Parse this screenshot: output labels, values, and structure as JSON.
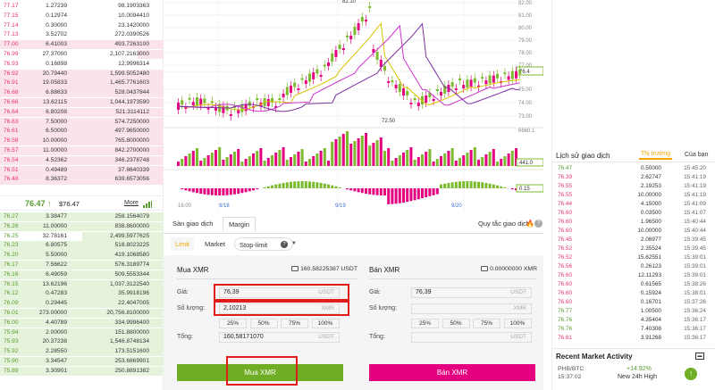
{
  "orderbook": {
    "asks": [
      {
        "price": "77.17",
        "amount": "1.27239",
        "total": "98.1903363",
        "depth": 0.0
      },
      {
        "price": "77.15",
        "amount": "0.12974",
        "total": "10.0094410",
        "depth": 0.0
      },
      {
        "price": "77.14",
        "amount": "0.30000",
        "total": "23.1420000",
        "depth": 0.0
      },
      {
        "price": "77.13",
        "amount": "3.52702",
        "total": "272.0390526",
        "depth": 0.0
      },
      {
        "price": "77.00",
        "amount": "6.41003",
        "total": "493.7263100",
        "depth": 1.0
      },
      {
        "price": "76.99",
        "amount": "27.37000",
        "total": "2,107.2163000",
        "depth": 0.16
      },
      {
        "price": "76.93",
        "amount": "0.16898",
        "total": "12.9996314",
        "depth": 0.0
      },
      {
        "price": "76.92",
        "amount": "20.79440",
        "total": "1,599.5052480",
        "depth": 1.0
      },
      {
        "price": "76.91",
        "amount": "19.05833",
        "total": "1,465.7761603",
        "depth": 1.0
      },
      {
        "price": "76.68",
        "amount": "6.88633",
        "total": "528.0437844",
        "depth": 1.0
      },
      {
        "price": "76.66",
        "amount": "13.62115",
        "total": "1,044.1973590",
        "depth": 1.0
      },
      {
        "price": "76.64",
        "amount": "6.80208",
        "total": "521.3114112",
        "depth": 1.0
      },
      {
        "price": "76.63",
        "amount": "7.50000",
        "total": "574.7250000",
        "depth": 1.0
      },
      {
        "price": "76.61",
        "amount": "6.50000",
        "total": "497.9650000",
        "depth": 1.0
      },
      {
        "price": "76.58",
        "amount": "10.00000",
        "total": "765.8000000",
        "depth": 1.0
      },
      {
        "price": "76.57",
        "amount": "11.00000",
        "total": "842.2700000",
        "depth": 1.0
      },
      {
        "price": "76.54",
        "amount": "4.52362",
        "total": "346.2378748",
        "depth": 1.0
      },
      {
        "price": "76.51",
        "amount": "0.49489",
        "total": "37.8640339",
        "depth": 1.0
      },
      {
        "price": "76.48",
        "amount": "8.36372",
        "total": "639.6573056",
        "depth": 1.0
      }
    ],
    "last_price": "76.47",
    "last_arrow": "↑",
    "last_usd": "$76.47",
    "more_label": "More",
    "bids": [
      {
        "price": "76.27",
        "amount": "3.38477",
        "total": "258.1564079",
        "depth": 1.0
      },
      {
        "price": "76.26",
        "amount": "11.00000",
        "total": "838.8600000",
        "depth": 1.0
      },
      {
        "price": "76.25",
        "amount": "32.78161",
        "total": "2,499.5977625",
        "depth": 0.5
      },
      {
        "price": "76.23",
        "amount": "6.80575",
        "total": "518.8023225",
        "depth": 1.0
      },
      {
        "price": "76.20",
        "amount": "5.50000",
        "total": "419.1068580",
        "depth": 1.0
      },
      {
        "price": "76.17",
        "amount": "7.56622",
        "total": "576.3189774",
        "depth": 1.0
      },
      {
        "price": "76.16",
        "amount": "6.49059",
        "total": "509.5553344",
        "depth": 1.0
      },
      {
        "price": "76.15",
        "amount": "13.62196",
        "total": "1,037.3122540",
        "depth": 1.0
      },
      {
        "price": "76.12",
        "amount": "0.47283",
        "total": "35.9918196",
        "depth": 1.0
      },
      {
        "price": "76.09",
        "amount": "0.29445",
        "total": "22.4047005",
        "depth": 1.0
      },
      {
        "price": "76.01",
        "amount": "273.00000",
        "total": "20,756.8100000",
        "depth": 1.0
      },
      {
        "price": "76.00",
        "amount": "4.40789",
        "total": "334.9996400",
        "depth": 1.0
      },
      {
        "price": "75.94",
        "amount": "2.00000",
        "total": "151.8800000",
        "depth": 1.0
      },
      {
        "price": "75.93",
        "amount": "20.37238",
        "total": "1,546.8748134",
        "depth": 1.0
      },
      {
        "price": "75.92",
        "amount": "2.28550",
        "total": "173.5151600",
        "depth": 1.0
      },
      {
        "price": "75.90",
        "amount": "3.34547",
        "total": "253.6869901",
        "depth": 1.0
      },
      {
        "price": "75.89",
        "amount": "3.30901",
        "total": "250.8891382",
        "depth": 1.0
      }
    ]
  },
  "chart": {
    "y_ticks": [
      "82.00",
      "81.00",
      "80.00",
      "79.00",
      "78.00",
      "77.00",
      "76.4",
      "75.00",
      "74.00",
      "73.00"
    ],
    "high_label": "82.10",
    "low_label": "72.50",
    "current_label": "76.4",
    "x_labels": [
      "16:00",
      "9/18",
      "9/19",
      "9/20"
    ],
    "vol_label": "6660.1",
    "vol_value": "441.0",
    "macd_value": "0.15",
    "colors": {
      "up": "#7cbb2e",
      "down": "#e4007f",
      "ma1": "#d9c400",
      "ma2": "#cc33cc",
      "ma3": "#7a2fa0"
    }
  },
  "tabs": {
    "exchange": "Sàn giao dịch",
    "margin": "Margin",
    "rules": "Quy tắc giao dịch",
    "fire_icon": "🔥",
    "help_icon": "?"
  },
  "order_types": {
    "limit": "Limit",
    "market": "Market",
    "stop_limit": "Stop-limit"
  },
  "buy": {
    "title": "Mua XMR",
    "balance": "160.58225387 USDT",
    "price_label": "Giá:",
    "price_value": "76,39",
    "price_unit": "USDT",
    "qty_label": "Số lượng:",
    "qty_value": "2,10213",
    "qty_unit": "XMR",
    "pcts": [
      "25%",
      "50%",
      "75%",
      "100%"
    ],
    "total_label": "Tổng:",
    "total_value": "160,58171070",
    "total_unit": "USDT",
    "button": "Mua XMR"
  },
  "sell": {
    "title": "Bán XMR",
    "balance": "0.00000000 XMR",
    "price_label": "Giá:",
    "price_value": "76,39",
    "price_unit": "USDT",
    "qty_label": "Số lượng:",
    "qty_value": "",
    "qty_unit": "XMR",
    "pcts": [
      "25%",
      "50%",
      "75%",
      "100%"
    ],
    "total_label": "Tổng:",
    "total_value": "",
    "total_unit": "USDT",
    "button": "Bán XMR"
  },
  "history": {
    "title": "Lịch sử giao dịch",
    "tab_market": "Thị trường",
    "tab_mine": "Của bạn",
    "rows": [
      {
        "p": "76.47",
        "a": "0.50000",
        "t": "15:45:20",
        "up": true
      },
      {
        "p": "76.39",
        "a": "2.62747",
        "t": "15:41:19",
        "up": false
      },
      {
        "p": "76.55",
        "a": "2.19253",
        "t": "15:41:19",
        "up": false
      },
      {
        "p": "76.55",
        "a": "10.00000",
        "t": "15:41:19",
        "up": false
      },
      {
        "p": "76.44",
        "a": "4.15000",
        "t": "15:41:09",
        "up": false
      },
      {
        "p": "76.60",
        "a": "0.03500",
        "t": "15:41:07",
        "up": false
      },
      {
        "p": "76.60",
        "a": "1.96500",
        "t": "15:40:44",
        "up": false
      },
      {
        "p": "76.60",
        "a": "10.00000",
        "t": "15:40:44",
        "up": false
      },
      {
        "p": "76.45",
        "a": "2.06977",
        "t": "15:39:45",
        "up": false
      },
      {
        "p": "76.52",
        "a": "2.35524",
        "t": "15:39:45",
        "up": false
      },
      {
        "p": "76.52",
        "a": "15.62551",
        "t": "15:39:01",
        "up": false
      },
      {
        "p": "76.56",
        "a": "0.26123",
        "t": "15:39:01",
        "up": false
      },
      {
        "p": "76.60",
        "a": "12.11293",
        "t": "15:39:01",
        "up": false
      },
      {
        "p": "76.60",
        "a": "0.61565",
        "t": "15:38:26",
        "up": false
      },
      {
        "p": "76.60",
        "a": "0.15924",
        "t": "15:38:01",
        "up": false
      },
      {
        "p": "76.60",
        "a": "0.16701",
        "t": "15:37:26",
        "up": false
      },
      {
        "p": "76.77",
        "a": "1.00500",
        "t": "15:36:24",
        "up": true
      },
      {
        "p": "76.76",
        "a": "4.35404",
        "t": "15:36:17",
        "up": true
      },
      {
        "p": "76.76",
        "a": "7.40308",
        "t": "15:36:17",
        "up": true
      },
      {
        "p": "76.61",
        "a": "3.91268",
        "t": "15:36:17",
        "up": false
      }
    ]
  },
  "activity": {
    "title": "Recent Market Activity",
    "pair": "PHB/BTC",
    "time": "15:37:02",
    "change": "+14.92%",
    "desc": "New 24h High"
  }
}
